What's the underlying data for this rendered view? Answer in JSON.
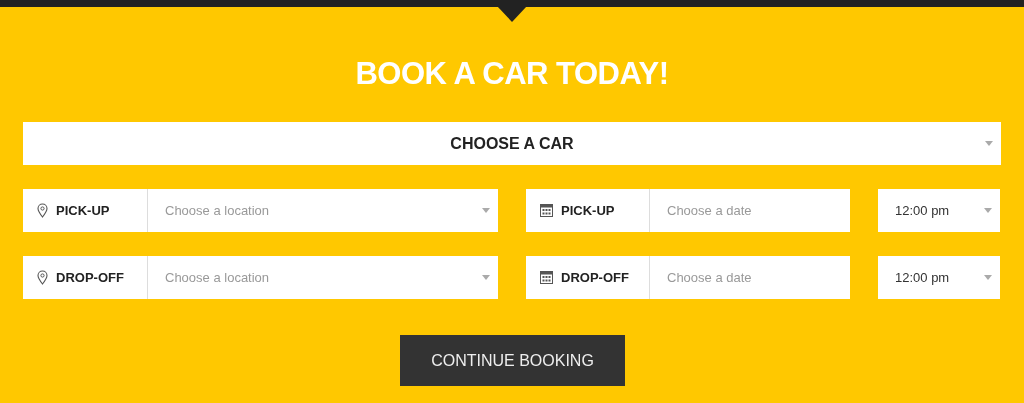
{
  "heading": "BOOK A CAR TODAY!",
  "car_select": {
    "value": "CHOOSE A CAR"
  },
  "rows": [
    {
      "location": {
        "label": "PICK-UP",
        "placeholder": "Choose a location"
      },
      "date": {
        "label": "PICK-UP",
        "placeholder": "Choose a date"
      },
      "time": {
        "value": "12:00 pm"
      }
    },
    {
      "location": {
        "label": "DROP-OFF",
        "placeholder": "Choose a location"
      },
      "date": {
        "label": "DROP-OFF",
        "placeholder": "Choose a date"
      },
      "time": {
        "value": "12:00 pm"
      }
    }
  ],
  "button": "CONTINUE BOOKING"
}
